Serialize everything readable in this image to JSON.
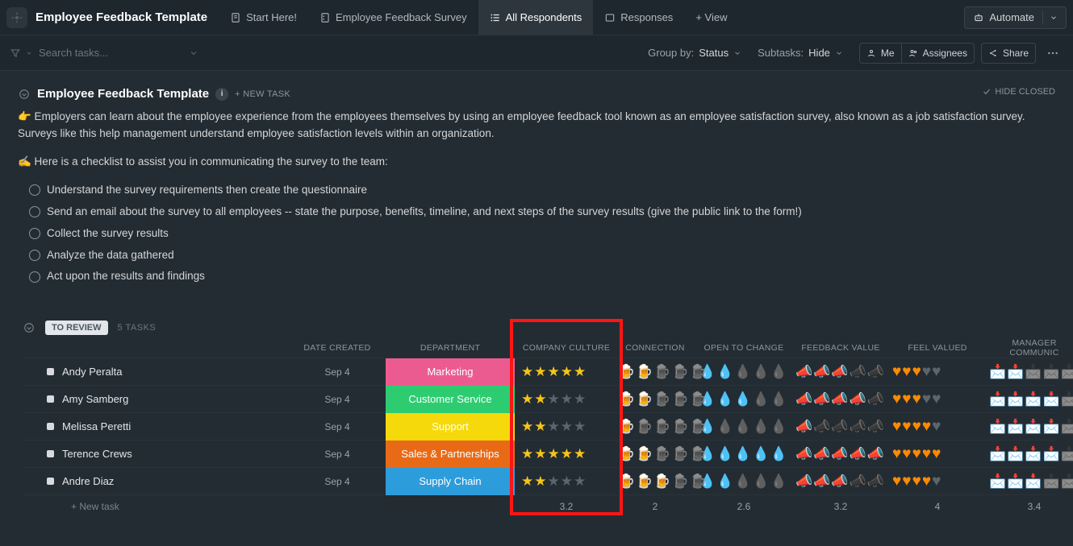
{
  "header": {
    "title": "Employee Feedback Template",
    "tabs": [
      {
        "label": "Start Here!"
      },
      {
        "label": "Employee Feedback Survey"
      },
      {
        "label": "All Respondents"
      },
      {
        "label": "Responses"
      },
      {
        "label": "+ View"
      }
    ],
    "automate": "Automate"
  },
  "toolbar": {
    "search_placeholder": "Search tasks...",
    "group_by_label": "Group by:",
    "group_by_value": "Status",
    "subtasks_label": "Subtasks:",
    "subtasks_value": "Hide",
    "me": "Me",
    "assignees": "Assignees",
    "share": "Share"
  },
  "section": {
    "title": "Employee Feedback Template",
    "new_task": "+ NEW TASK",
    "hide_closed": "HIDE CLOSED",
    "desc_p1": "👉 Employers can learn about the employee experience from the employees themselves by using an employee feedback tool known as an employee satisfaction survey, also known as a job satisfaction survey. Surveys like this help management understand employee satisfaction levels within an organization.",
    "desc_p2": "✍️ Here is a checklist to assist you in communicating the survey to the team:",
    "checklist": [
      "Understand the survey requirements then create the questionnaire",
      "Send an email about the survey to all employees -- state the purpose, benefits, timeline, and next steps of the survey results (give the public link to the form!)",
      "Collect the survey results",
      "Analyze the data gathered",
      "Act upon the results and findings"
    ]
  },
  "group": {
    "status": "TO REVIEW",
    "count_label": "5 TASKS",
    "columns": {
      "date_created": "DATE CREATED",
      "department": "DEPARTMENT",
      "company_culture": "COMPANY CULTURE",
      "connection": "CONNECTION",
      "open_to_change": "OPEN TO CHANGE",
      "feedback_value": "FEEDBACK VALUE",
      "feel_valued": "FEEL VALUED",
      "manager_comm": "MANAGER COMMUNIC"
    },
    "rows": [
      {
        "name": "Andy Peralta",
        "date": "Sep 4",
        "dept": "Marketing",
        "dept_color": "#ec5b8f",
        "culture": 5,
        "connection": 2,
        "open": 2,
        "feedback": 3,
        "valued": 3,
        "manager": 2
      },
      {
        "name": "Amy Samberg",
        "date": "Sep 4",
        "dept": "Customer Service",
        "dept_color": "#2ecc71",
        "culture": 2,
        "connection": 2,
        "open": 3,
        "feedback": 4,
        "valued": 3,
        "manager": 4
      },
      {
        "name": "Melissa Peretti",
        "date": "Sep 4",
        "dept": "Support",
        "dept_color": "#f5d90a",
        "culture": 2,
        "connection": 1,
        "open": 1,
        "feedback": 1,
        "valued": 4,
        "manager": 4
      },
      {
        "name": "Terence Crews",
        "date": "Sep 4",
        "dept": "Sales & Partnerships",
        "dept_color": "#e86a17",
        "culture": 5,
        "connection": 2,
        "open": 5,
        "feedback": 5,
        "valued": 5,
        "manager": 4
      },
      {
        "name": "Andre Diaz",
        "date": "Sep 4",
        "dept": "Supply Chain",
        "dept_color": "#2d9cdb",
        "culture": 2,
        "connection": 3,
        "open": 2,
        "feedback": 3,
        "valued": 4,
        "manager": 3
      }
    ],
    "averages": {
      "culture": "3.2",
      "connection": "2",
      "open": "2.6",
      "feedback": "3.2",
      "valued": "4",
      "manager": "3.4"
    },
    "new_task": "+ New task"
  }
}
